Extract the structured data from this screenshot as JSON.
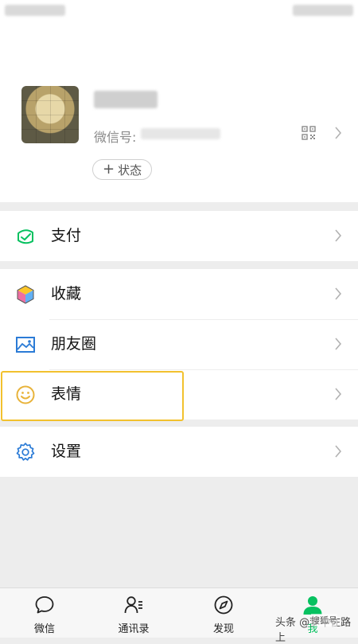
{
  "profile": {
    "wechat_id_label": "微信号:",
    "status_plus": "+",
    "status_label": "状态"
  },
  "menu": {
    "pay": "支付",
    "favorites": "收藏",
    "moments": "朋友圈",
    "stickers": "表情",
    "settings": "设置"
  },
  "tabs": [
    {
      "label": "微信"
    },
    {
      "label": "通讯录"
    },
    {
      "label": "发现"
    },
    {
      "label": "我"
    }
  ],
  "watermark": {
    "source": "头条",
    "name": "@梦中在路上",
    "logo_text": "搜狐号"
  },
  "colors": {
    "accent": "#07c160",
    "highlight_border": "#f2c12e",
    "page_bg": "#ededed"
  }
}
